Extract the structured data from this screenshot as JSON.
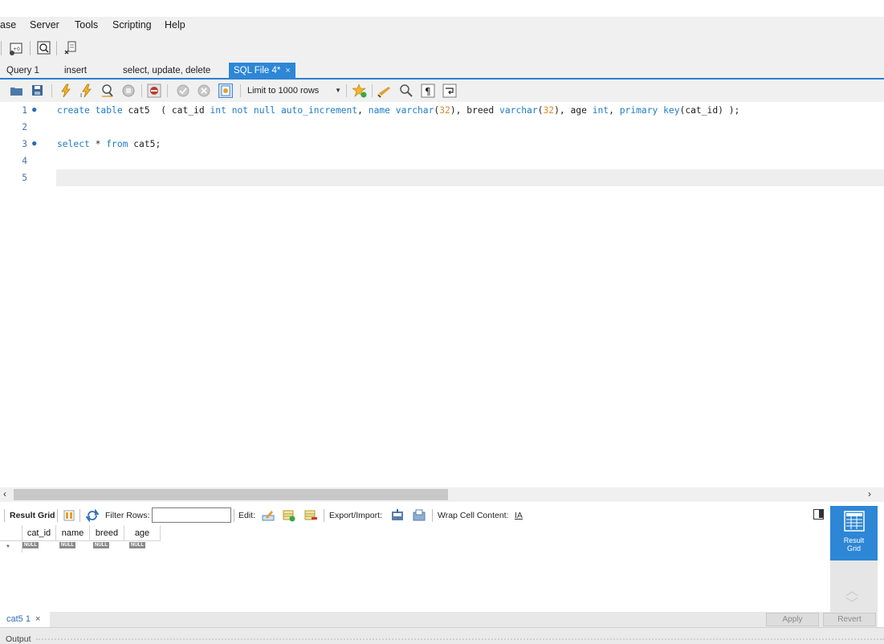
{
  "menu": {
    "items": [
      "ase",
      "Server",
      "Tools",
      "Scripting",
      "Help"
    ]
  },
  "tabs": [
    {
      "label": "Query 1",
      "active": false
    },
    {
      "label": "insert",
      "active": false
    },
    {
      "label": "select, update, delete",
      "active": false
    },
    {
      "label": "SQL File 4*",
      "active": true,
      "close": "×"
    }
  ],
  "sql_toolbar": {
    "limit_label": "Limit to 1000 rows"
  },
  "editor": {
    "lines": [
      {
        "number": "1",
        "marker": "●"
      },
      {
        "number": "2",
        "marker": ""
      },
      {
        "number": "3",
        "marker": "●"
      },
      {
        "number": "4",
        "marker": ""
      },
      {
        "number": "5",
        "marker": ""
      }
    ],
    "line1_tokens": [
      "create",
      " ",
      "table",
      " cat5  ( cat_id ",
      "int",
      " ",
      "not",
      " ",
      "null",
      " ",
      "auto_increment",
      ", ",
      "name",
      " ",
      "varchar",
      "(",
      "32",
      "), breed ",
      "varchar",
      "(",
      "32",
      "), age ",
      "int",
      ", ",
      "primary",
      " ",
      "key",
      "(cat_id) );"
    ],
    "line3_tokens": [
      "select",
      " * ",
      "from",
      " cat5;"
    ]
  },
  "scroll": {
    "left_arrow": "‹",
    "right_arrow": "›"
  },
  "result_toolbar": {
    "result_grid_label": "Result Grid",
    "filter_rows_label": "Filter Rows:",
    "filter_value": "",
    "edit_label": "Edit:",
    "export_import_label": "Export/Import:",
    "wrap_label": "Wrap Cell Content:",
    "wrap_icon_text": "IA"
  },
  "grid": {
    "columns": [
      "cat_id",
      "name",
      "breed",
      "age"
    ],
    "row_marker": "*",
    "null_value": "NULL"
  },
  "side_panel": {
    "result_grid_label_1": "Result",
    "result_grid_label_2": "Grid"
  },
  "bottom": {
    "result_tab_label": "cat5 1",
    "result_tab_close": "×",
    "apply_label": "Apply",
    "revert_label": "Revert"
  },
  "output": {
    "label": "Output"
  },
  "colors": {
    "accent": "#2d86d6",
    "keyword": "#1f7cc4",
    "number": "#e08a2c",
    "line_number": "#4a73b0"
  },
  "icons": {
    "main_toolbar": [
      "new-connection-icon",
      "inspector-icon",
      "sql-wizard-icon"
    ],
    "sql_toolbar": [
      "open-file-icon",
      "save-icon",
      "execute-icon",
      "execute-current-icon",
      "explain-icon",
      "stop-icon",
      "toggle-error-icon",
      "commit-icon",
      "rollback-icon",
      "autocommit-icon",
      "limit-caret-icon",
      "add-snippet-icon",
      "beautify-icon",
      "find-icon",
      "invisibles-icon",
      "wrap-icon"
    ]
  }
}
